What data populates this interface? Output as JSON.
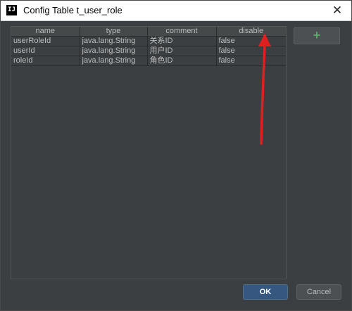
{
  "window": {
    "app_icon": "IJ",
    "title": "Config Table t_user_role",
    "close_glyph": "✕"
  },
  "table": {
    "columns": [
      "name",
      "type",
      "comment",
      "disable"
    ],
    "rows": [
      [
        "userRoleId",
        "java.lang.String",
        "关系ID",
        "false"
      ],
      [
        "userId",
        "java.lang.String",
        "用户ID",
        "false"
      ],
      [
        "roleId",
        "java.lang.String",
        "角色ID",
        "false"
      ]
    ]
  },
  "actions": {
    "add_label": "+",
    "ok_label": "OK",
    "cancel_label": "Cancel"
  },
  "colors": {
    "background": "#3c3f41",
    "header": "#45494a",
    "ok_button": "#365880",
    "add_icon": "#59a869",
    "annotation_arrow": "#e02020"
  },
  "icons": {
    "app": "intellij-icon",
    "close": "close-icon",
    "add": "plus-icon",
    "annotation": "red-arrow-icon"
  }
}
